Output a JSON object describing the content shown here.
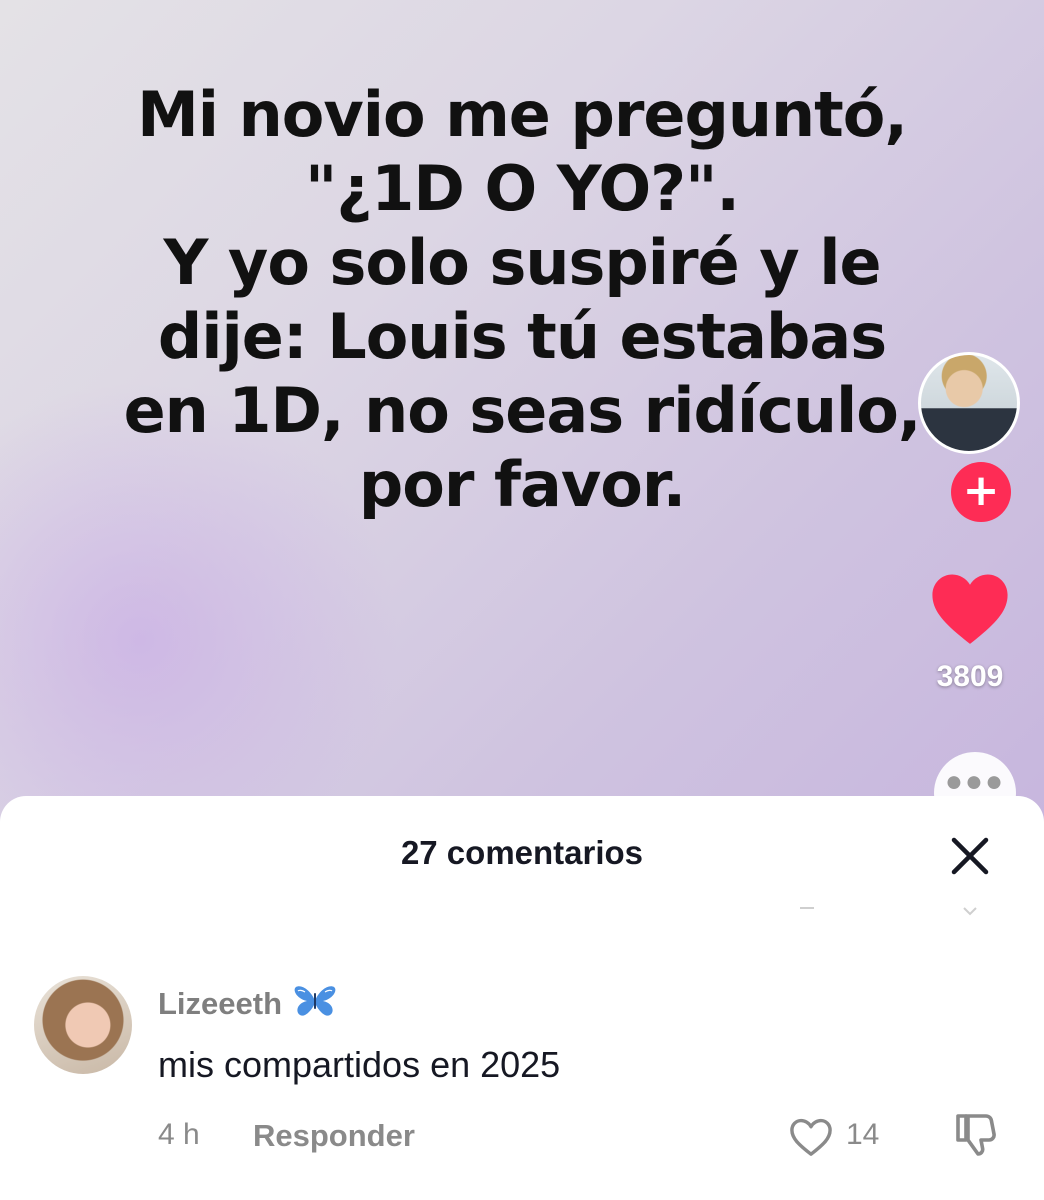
{
  "video": {
    "caption_text": "Mi novio me preguntó,\n\"¿1D O YO?\".\nY yo solo suspiré y le\ndije: Louis tú estabas\nen 1D, no seas ridículo,\npor favor.",
    "like_count": "3809",
    "follow_icon": "plus-icon",
    "more_icon": "ellipsis-icon"
  },
  "comments_sheet": {
    "title": "27 comentarios",
    "close_icon": "close-icon",
    "comment": {
      "username": "Lizeeeth",
      "username_emoji": "butterfly-icon",
      "text": "mis compartidos en 2025",
      "time": "4 h",
      "reply_label": "Responder",
      "like_count": "14"
    }
  },
  "colors": {
    "accent": "#fe2c55",
    "butterfly": "#4a90e2",
    "secondary_text": "#8a8a8a"
  }
}
